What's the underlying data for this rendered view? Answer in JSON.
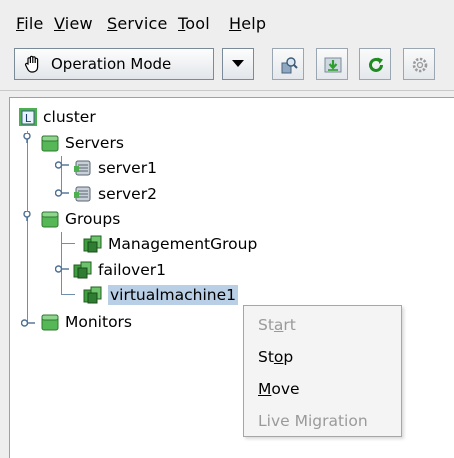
{
  "menubar": {
    "items": [
      {
        "mnemonic": "F",
        "rest": "ile"
      },
      {
        "mnemonic": "V",
        "rest": "iew"
      },
      {
        "mnemonic": "S",
        "rest": "ervice"
      },
      {
        "mnemonic": "T",
        "rest": "ool"
      },
      {
        "mnemonic": "H",
        "rest": "elp"
      }
    ]
  },
  "toolbar": {
    "mode_label": "Operation Mode",
    "mode_icon": "hand-icon",
    "buttons": [
      "browse-icon",
      "download-icon",
      "refresh-icon",
      "settings-icon"
    ]
  },
  "tree": {
    "root": {
      "label": "cluster",
      "icon": "cluster-icon"
    },
    "servers": {
      "label": "Servers",
      "icon": "folder-icon",
      "expanded": true
    },
    "server1": {
      "label": "server1",
      "icon": "server-icon",
      "expanded": false
    },
    "server2": {
      "label": "server2",
      "icon": "server-icon",
      "expanded": false
    },
    "groups": {
      "label": "Groups",
      "icon": "folder-icon",
      "expanded": true
    },
    "mgmt": {
      "label": "ManagementGroup",
      "icon": "group-icon"
    },
    "failover1": {
      "label": "failover1",
      "icon": "group-icon",
      "expanded": false
    },
    "vm1": {
      "label": "virtualmachine1",
      "icon": "group-icon",
      "selected": true
    },
    "monitors": {
      "label": "Monitors",
      "icon": "folder-icon",
      "expanded": false
    }
  },
  "context_menu": {
    "start": {
      "pre": "St",
      "mnemonic": "a",
      "post": "rt",
      "enabled": false
    },
    "stop": {
      "pre": "St",
      "mnemonic": "o",
      "post": "p",
      "enabled": true
    },
    "move": {
      "pre": "",
      "mnemonic": "M",
      "post": "ove",
      "enabled": true
    },
    "live_migration": {
      "label": "Live Migration",
      "enabled": false
    }
  }
}
